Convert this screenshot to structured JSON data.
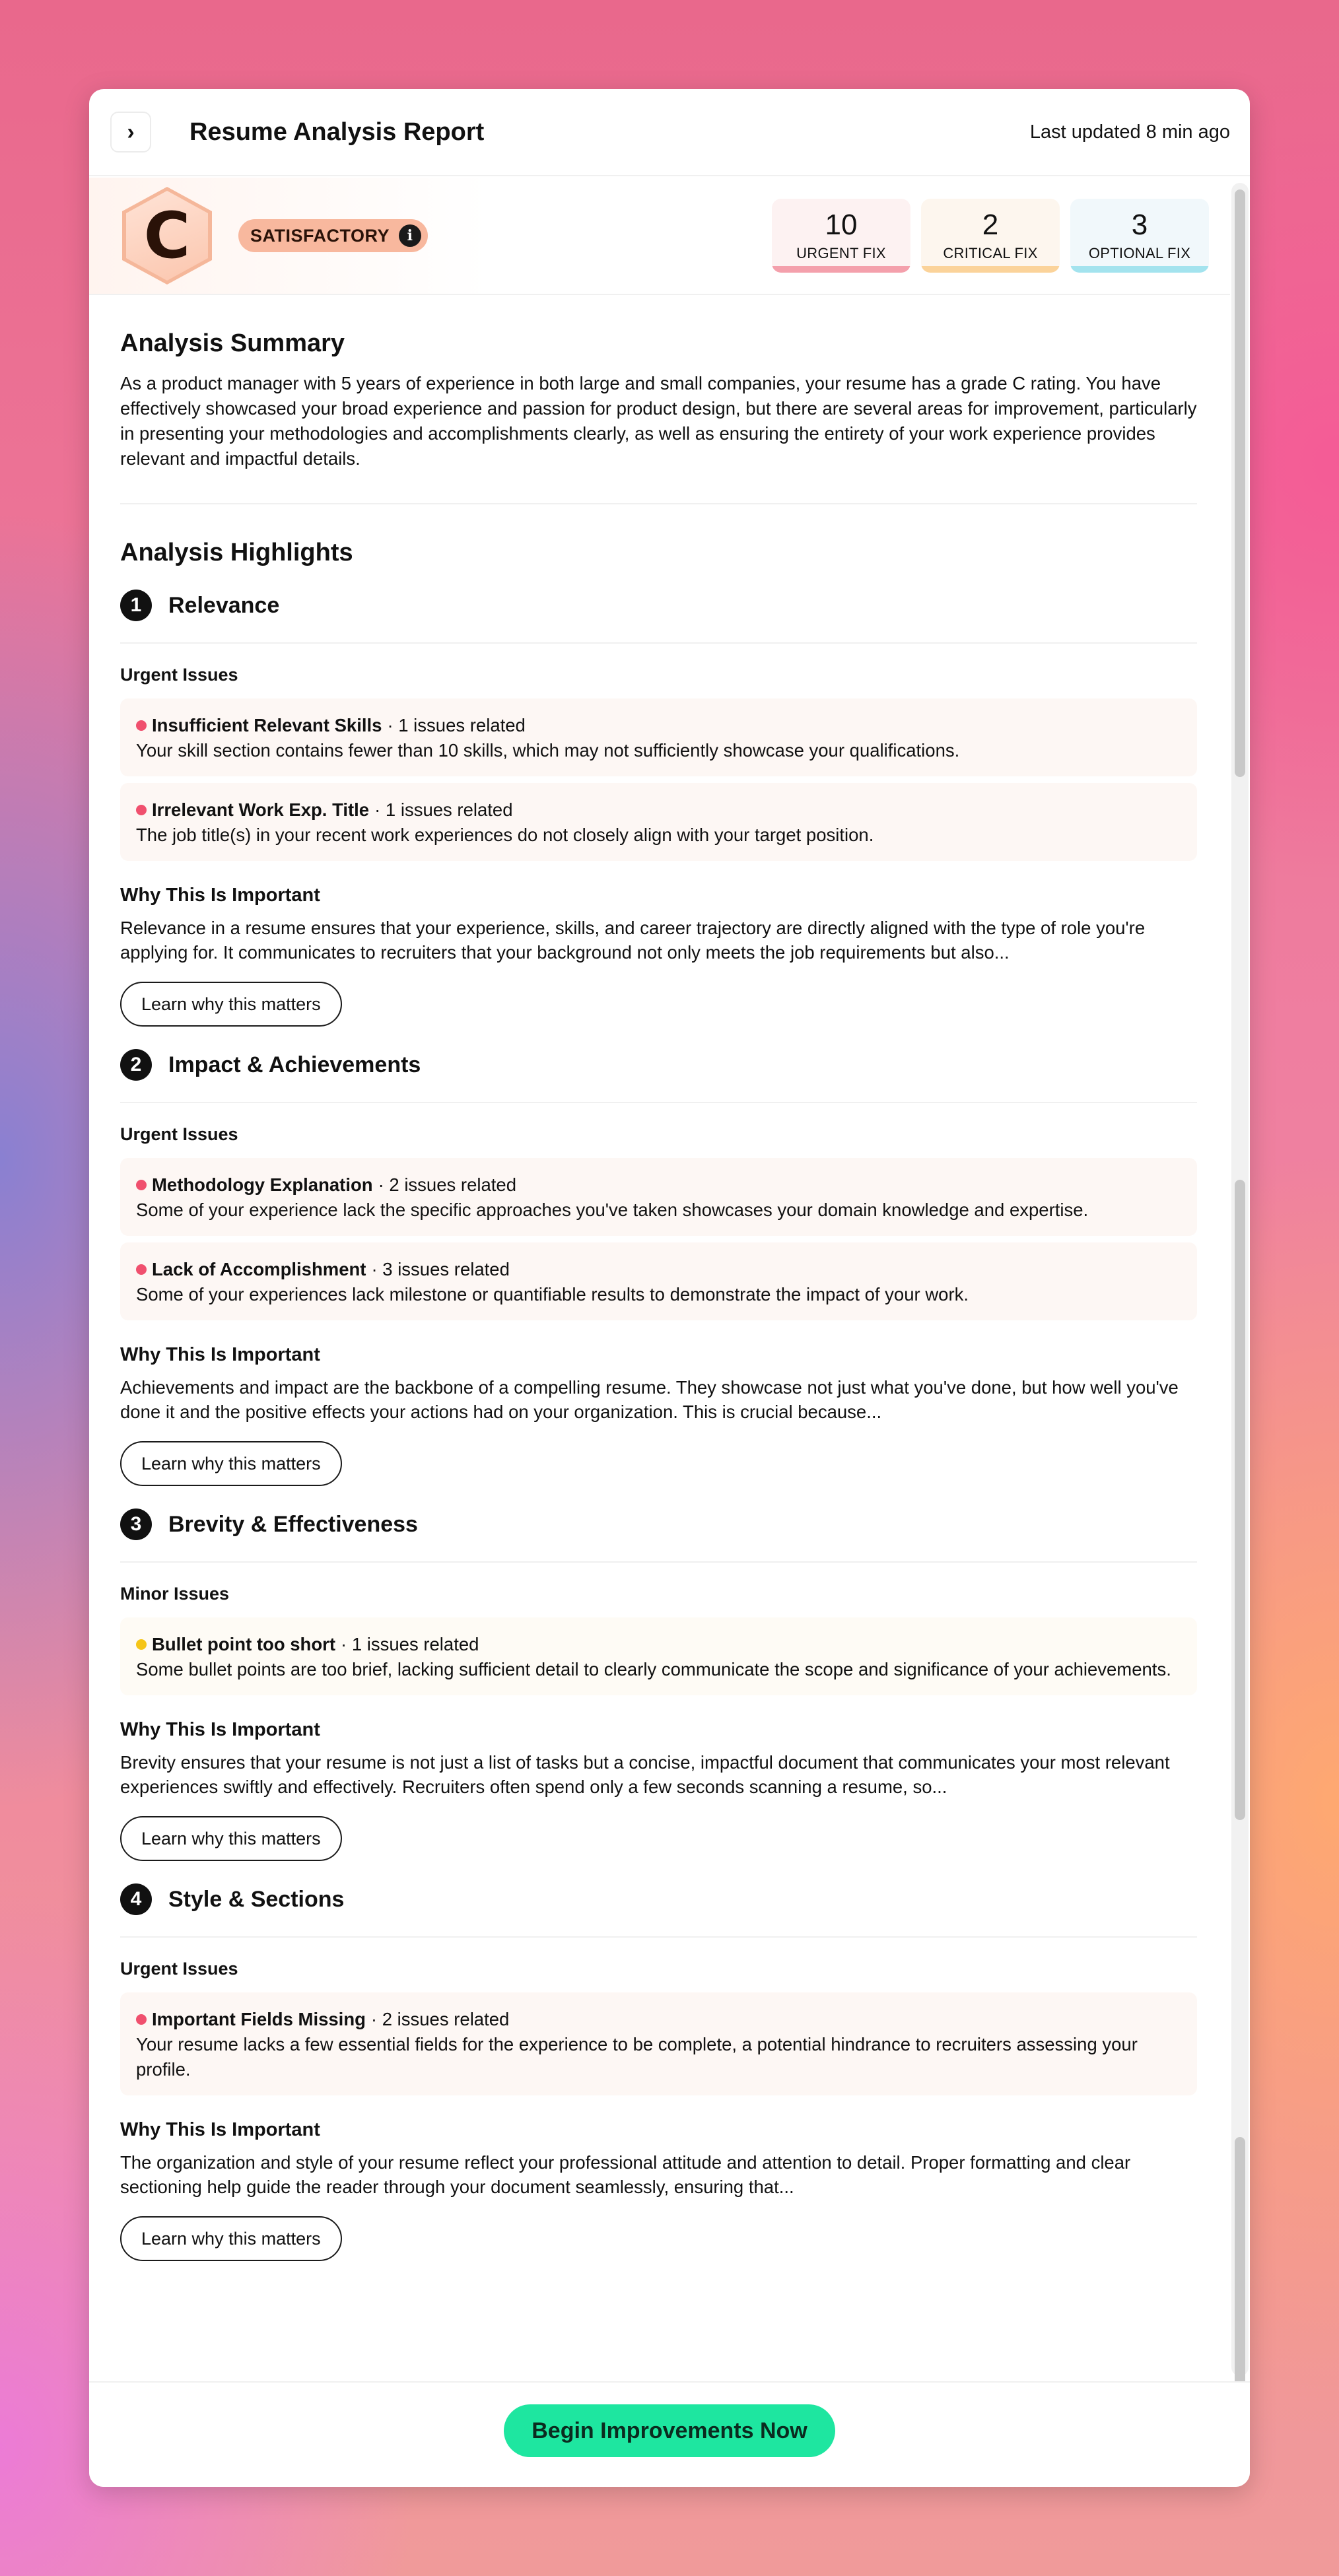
{
  "header": {
    "collapse_icon": "chevron-right-icon",
    "title": "Resume Analysis Report",
    "last_updated": "Last updated 8 min ago"
  },
  "grade": {
    "letter": "C",
    "label": "SATISFACTORY",
    "info_icon": "info-icon"
  },
  "counts": [
    {
      "value": "10",
      "label": "URGENT FIX",
      "color": "#f4a0ac",
      "bg": "#fdf2f2"
    },
    {
      "value": "2",
      "label": "CRITICAL FIX",
      "color": "#fbd39a",
      "bg": "#fdf6ee"
    },
    {
      "value": "3",
      "label": "OPTIONAL FIX",
      "color": "#a3e3ee",
      "bg": "#f1f8fb"
    }
  ],
  "summary": {
    "title": "Analysis Summary",
    "text": "As a product manager with 5 years of experience in both large and small companies, your resume has a grade C rating. You have effectively showcased your broad experience and passion for product design, but there are several areas for improvement, particularly in presenting your methodologies and accomplishments clearly, as well as ensuring the entirety of your work experience provides relevant and impactful details."
  },
  "highlights": {
    "title": "Analysis Highlights",
    "topics": [
      {
        "num": "1",
        "title": "Relevance",
        "issues_label": "Urgent Issues",
        "issues": [
          {
            "name": "Insufficient Relevant Skills",
            "count": "· 1 issues related",
            "desc": "Your skill section contains fewer than 10 skills, which may not sufficiently showcase your qualifications."
          },
          {
            "name": "Irrelevant Work Exp. Title",
            "count": "· 1 issues related",
            "desc": "The job title(s) in your recent work experiences do not closely align with your target position."
          }
        ],
        "why_title": "Why This Is Important",
        "why_text": "Relevance in a resume ensures that your experience, skills, and career trajectory are directly aligned with the type of role you're applying for. It communicates to recruiters that your background not only meets the job requirements but also...",
        "button": "Learn why this matters"
      },
      {
        "num": "2",
        "title": "Impact & Achievements",
        "issues_label": "Urgent Issues",
        "issues": [
          {
            "name": "Methodology Explanation",
            "count": "· 2 issues related",
            "desc": "Some of your experience lack the specific approaches you've taken showcases your domain knowledge and expertise."
          },
          {
            "name": "Lack of Accomplishment",
            "count": "· 3 issues related",
            "desc": "Some of your experiences lack milestone or quantifiable results to demonstrate the impact of your work."
          }
        ],
        "why_title": "Why This Is Important",
        "why_text": "Achievements and impact are the backbone of a compelling resume. They showcase not just what you've done, but how well you've done it and the positive effects your actions had on your organization. This is crucial because...",
        "button": "Learn why this matters"
      },
      {
        "num": "3",
        "title": "Brevity & Effectiveness",
        "issues_label": "Minor Issues",
        "issues": [
          {
            "name": "Bullet point too short",
            "count": "· 1 issues related",
            "desc": "Some bullet points are too brief, lacking sufficient detail to clearly communicate the scope and significance of your achievements."
          }
        ],
        "why_title": "Why This Is Important",
        "why_text": "Brevity ensures that your resume is not just a list of tasks but a concise, impactful document that communicates your most relevant experiences swiftly and effectively. Recruiters often spend only a few seconds scanning a resume, so...",
        "button": "Learn why this matters"
      },
      {
        "num": "4",
        "title": "Style & Sections",
        "issues_label": "Urgent Issues",
        "issues": [
          {
            "name": "Important Fields Missing",
            "count": "· 2 issues related",
            "desc": "Your resume lacks a few essential fields for the experience to be complete, a potential hindrance to recruiters assessing your profile."
          }
        ],
        "why_title": "Why This Is Important",
        "why_text": "The organization and style of your resume reflect your professional attitude and attention to detail. Proper formatting and clear sectioning help guide the reader through your document seamlessly, ensuring that...",
        "button": "Learn why this matters"
      }
    ]
  },
  "colors": {
    "urgent_dot": "#f0506e",
    "minor_dot": "#f5c518",
    "cta": "#1ee6a0"
  },
  "footer": {
    "cta": "Begin Improvements Now"
  }
}
